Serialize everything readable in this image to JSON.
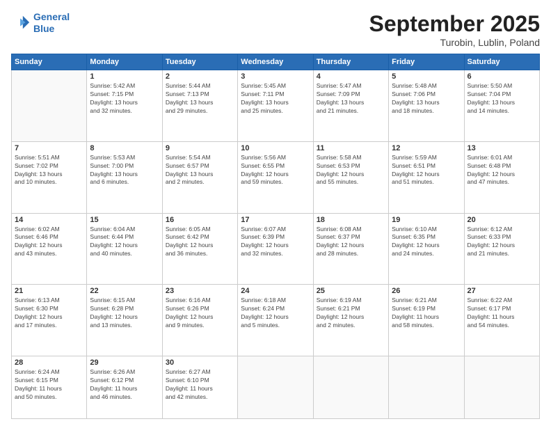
{
  "header": {
    "logo_line1": "General",
    "logo_line2": "Blue",
    "month": "September 2025",
    "location": "Turobin, Lublin, Poland"
  },
  "weekdays": [
    "Sunday",
    "Monday",
    "Tuesday",
    "Wednesday",
    "Thursday",
    "Friday",
    "Saturday"
  ],
  "weeks": [
    [
      {
        "day": "",
        "info": ""
      },
      {
        "day": "1",
        "info": "Sunrise: 5:42 AM\nSunset: 7:15 PM\nDaylight: 13 hours\nand 32 minutes."
      },
      {
        "day": "2",
        "info": "Sunrise: 5:44 AM\nSunset: 7:13 PM\nDaylight: 13 hours\nand 29 minutes."
      },
      {
        "day": "3",
        "info": "Sunrise: 5:45 AM\nSunset: 7:11 PM\nDaylight: 13 hours\nand 25 minutes."
      },
      {
        "day": "4",
        "info": "Sunrise: 5:47 AM\nSunset: 7:09 PM\nDaylight: 13 hours\nand 21 minutes."
      },
      {
        "day": "5",
        "info": "Sunrise: 5:48 AM\nSunset: 7:06 PM\nDaylight: 13 hours\nand 18 minutes."
      },
      {
        "day": "6",
        "info": "Sunrise: 5:50 AM\nSunset: 7:04 PM\nDaylight: 13 hours\nand 14 minutes."
      }
    ],
    [
      {
        "day": "7",
        "info": "Sunrise: 5:51 AM\nSunset: 7:02 PM\nDaylight: 13 hours\nand 10 minutes."
      },
      {
        "day": "8",
        "info": "Sunrise: 5:53 AM\nSunset: 7:00 PM\nDaylight: 13 hours\nand 6 minutes."
      },
      {
        "day": "9",
        "info": "Sunrise: 5:54 AM\nSunset: 6:57 PM\nDaylight: 13 hours\nand 2 minutes."
      },
      {
        "day": "10",
        "info": "Sunrise: 5:56 AM\nSunset: 6:55 PM\nDaylight: 12 hours\nand 59 minutes."
      },
      {
        "day": "11",
        "info": "Sunrise: 5:58 AM\nSunset: 6:53 PM\nDaylight: 12 hours\nand 55 minutes."
      },
      {
        "day": "12",
        "info": "Sunrise: 5:59 AM\nSunset: 6:51 PM\nDaylight: 12 hours\nand 51 minutes."
      },
      {
        "day": "13",
        "info": "Sunrise: 6:01 AM\nSunset: 6:48 PM\nDaylight: 12 hours\nand 47 minutes."
      }
    ],
    [
      {
        "day": "14",
        "info": "Sunrise: 6:02 AM\nSunset: 6:46 PM\nDaylight: 12 hours\nand 43 minutes."
      },
      {
        "day": "15",
        "info": "Sunrise: 6:04 AM\nSunset: 6:44 PM\nDaylight: 12 hours\nand 40 minutes."
      },
      {
        "day": "16",
        "info": "Sunrise: 6:05 AM\nSunset: 6:42 PM\nDaylight: 12 hours\nand 36 minutes."
      },
      {
        "day": "17",
        "info": "Sunrise: 6:07 AM\nSunset: 6:39 PM\nDaylight: 12 hours\nand 32 minutes."
      },
      {
        "day": "18",
        "info": "Sunrise: 6:08 AM\nSunset: 6:37 PM\nDaylight: 12 hours\nand 28 minutes."
      },
      {
        "day": "19",
        "info": "Sunrise: 6:10 AM\nSunset: 6:35 PM\nDaylight: 12 hours\nand 24 minutes."
      },
      {
        "day": "20",
        "info": "Sunrise: 6:12 AM\nSunset: 6:33 PM\nDaylight: 12 hours\nand 21 minutes."
      }
    ],
    [
      {
        "day": "21",
        "info": "Sunrise: 6:13 AM\nSunset: 6:30 PM\nDaylight: 12 hours\nand 17 minutes."
      },
      {
        "day": "22",
        "info": "Sunrise: 6:15 AM\nSunset: 6:28 PM\nDaylight: 12 hours\nand 13 minutes."
      },
      {
        "day": "23",
        "info": "Sunrise: 6:16 AM\nSunset: 6:26 PM\nDaylight: 12 hours\nand 9 minutes."
      },
      {
        "day": "24",
        "info": "Sunrise: 6:18 AM\nSunset: 6:24 PM\nDaylight: 12 hours\nand 5 minutes."
      },
      {
        "day": "25",
        "info": "Sunrise: 6:19 AM\nSunset: 6:21 PM\nDaylight: 12 hours\nand 2 minutes."
      },
      {
        "day": "26",
        "info": "Sunrise: 6:21 AM\nSunset: 6:19 PM\nDaylight: 11 hours\nand 58 minutes."
      },
      {
        "day": "27",
        "info": "Sunrise: 6:22 AM\nSunset: 6:17 PM\nDaylight: 11 hours\nand 54 minutes."
      }
    ],
    [
      {
        "day": "28",
        "info": "Sunrise: 6:24 AM\nSunset: 6:15 PM\nDaylight: 11 hours\nand 50 minutes."
      },
      {
        "day": "29",
        "info": "Sunrise: 6:26 AM\nSunset: 6:12 PM\nDaylight: 11 hours\nand 46 minutes."
      },
      {
        "day": "30",
        "info": "Sunrise: 6:27 AM\nSunset: 6:10 PM\nDaylight: 11 hours\nand 42 minutes."
      },
      {
        "day": "",
        "info": ""
      },
      {
        "day": "",
        "info": ""
      },
      {
        "day": "",
        "info": ""
      },
      {
        "day": "",
        "info": ""
      }
    ]
  ]
}
